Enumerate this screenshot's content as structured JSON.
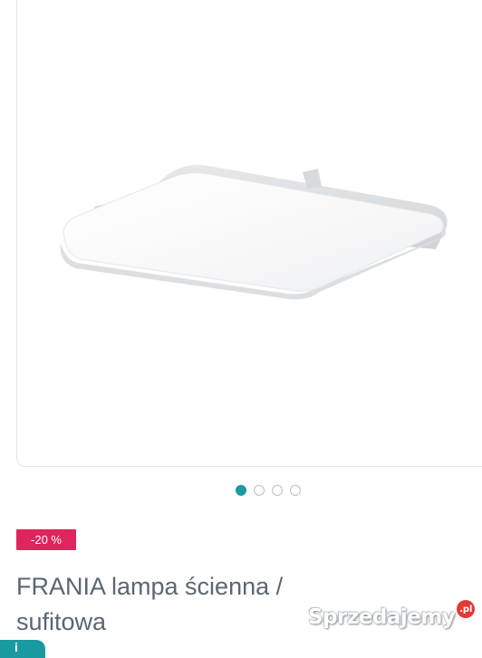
{
  "gallery": {
    "image_alt_icon": "ceiling-lamp-image",
    "dots_total": 4,
    "active_dot_index": 0,
    "accent_color": "#1a9aa0"
  },
  "product": {
    "discount_badge": "-20 %",
    "discount_color": "#e0245e",
    "title": "FRANIA lampa ścienna / sufitowa"
  },
  "watermark": {
    "brand": "Sprzedajemy",
    "tld": ".pl"
  },
  "corner_tab": {
    "label": "i"
  }
}
